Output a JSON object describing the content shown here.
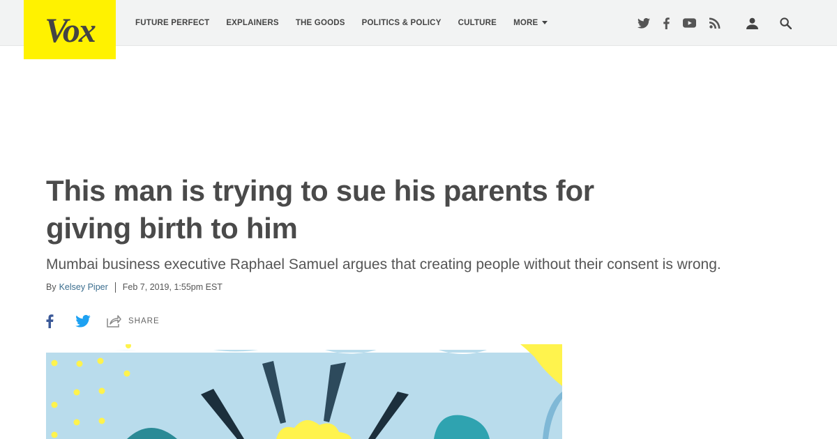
{
  "brand": {
    "logo_text": "Vox",
    "logo_bg": "#fff200"
  },
  "nav": {
    "items": [
      {
        "label": "FUTURE PERFECT"
      },
      {
        "label": "EXPLAINERS"
      },
      {
        "label": "THE GOODS"
      },
      {
        "label": "POLITICS & POLICY"
      },
      {
        "label": "CULTURE"
      },
      {
        "label": "MORE",
        "has_dropdown": true
      }
    ],
    "social_icons": [
      "twitter-icon",
      "facebook-icon",
      "youtube-icon",
      "rss-icon"
    ],
    "utility_icons": [
      "user-icon",
      "search-icon"
    ]
  },
  "article": {
    "headline": "This man is trying to sue his parents for giving birth to him",
    "dek": "Mumbai business executive Raphael Samuel argues that creating people without their consent is wrong.",
    "byline_prefix": "By",
    "author": "Kelsey Piper",
    "timestamp": "Feb 7, 2019, 1:55pm EST",
    "share_label": "SHARE",
    "share_icons": [
      "facebook-icon",
      "twitter-icon",
      "share-icon"
    ]
  },
  "colors": {
    "facebook": "#3b5998",
    "twitter": "#1da1f2",
    "author_link": "#3b6e8f",
    "headline": "#4a4a4a",
    "nav_bg": "#f2f3f3"
  }
}
